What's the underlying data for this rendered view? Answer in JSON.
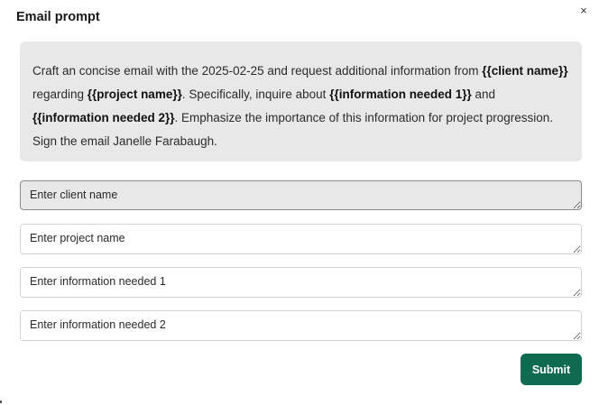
{
  "dialog": {
    "title": "Email prompt",
    "close_icon": "×"
  },
  "prompt": {
    "parts": [
      {
        "text": "Craft an concise email with the 2025-02-25 and request additional information from ",
        "bold": false
      },
      {
        "text": "{{client name}}",
        "bold": true
      },
      {
        "text": " regarding ",
        "bold": false
      },
      {
        "text": "{{project name}}",
        "bold": true
      },
      {
        "text": ". Specifically, inquire about ",
        "bold": false
      },
      {
        "text": "{{information needed 1}}",
        "bold": true
      },
      {
        "text": " and ",
        "bold": false
      },
      {
        "text": "{{information needed 2}}",
        "bold": true
      },
      {
        "text": ". Emphasize the importance of this information for project progression. Sign the email Janelle Farabaugh.",
        "bold": false
      }
    ]
  },
  "fields": {
    "client_name": {
      "placeholder": "Enter client name",
      "value": ""
    },
    "project_name": {
      "placeholder": "Enter project name",
      "value": ""
    },
    "info_1": {
      "placeholder": "Enter information needed 1",
      "value": ""
    },
    "info_2": {
      "placeholder": "Enter information needed 2",
      "value": ""
    }
  },
  "actions": {
    "submit_label": "Submit"
  },
  "colors": {
    "submit_bg": "#0f6b4f",
    "prompt_bg": "#e8e8e8"
  }
}
